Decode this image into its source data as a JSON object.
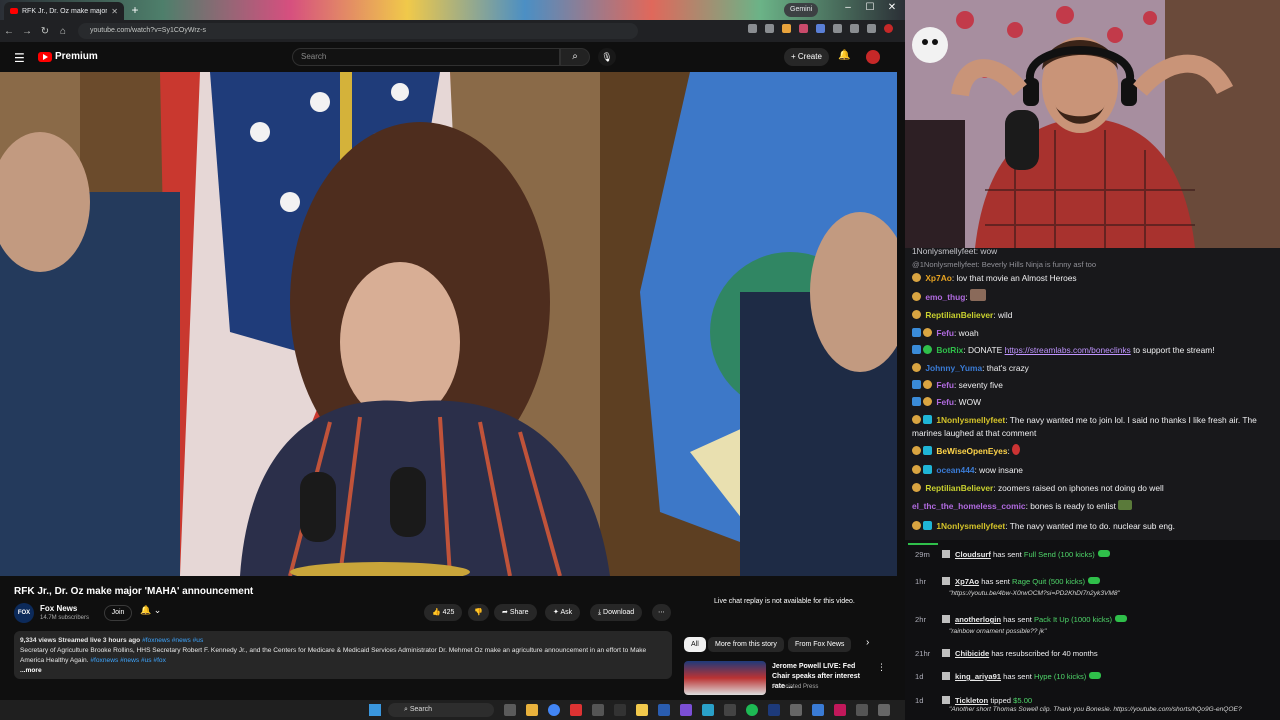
{
  "browser": {
    "tab_title": "RFK Jr., Dr. Oz make major 'MA",
    "gemini_label": "Gemini",
    "url": "youtube.com/watch?v=Sy1COyWrz-s"
  },
  "youtube": {
    "brand": "Premium",
    "search_placeholder": "Search",
    "create_label": "Create"
  },
  "video": {
    "title": "RFK Jr., Dr. Oz make major 'MAHA' announcement",
    "channel": "Fox News",
    "subscribers": "14.7M subscribers",
    "join_label": "Join",
    "likes": "425",
    "share_label": "Share",
    "ask_label": "Ask",
    "download_label": "Download",
    "description": {
      "meta": "9,334 views  Streamed live 3 hours ago",
      "meta_tags": "#foxnews #news #us",
      "body": "Secretary of Agriculture Brooke Rollins, HHS Secretary Robert F. Kennedy Jr., and the Centers for Medicare & Medicaid Services Administrator Dr. Mehmet Oz make an agriculture announcement in an effort to Make America Healthy Again.",
      "body_tags": "#foxnews #news #us #fox",
      "more": "...more"
    }
  },
  "sidebar": {
    "replay_note": "Live chat replay is not available for this video.",
    "chips": [
      "All",
      "More from this story",
      "From Fox News"
    ],
    "rec_title": "Jerome Powell LIVE: Fed Chair speaks after interest rate ...",
    "rec_channel": "Associated Press"
  },
  "chat": {
    "top_cut": "1Nonlysmellyfeet: wow",
    "reply": "@1Nonlysmellyfeet: Beverly Hills Ninja is funny asf too",
    "messages": [
      {
        "user": "Xp7Ao",
        "color": "#e7a321",
        "text": "lov that movie an Almost Heroes"
      },
      {
        "user": "emo_thug",
        "color": "#b06adf",
        "text": ""
      },
      {
        "user": "ReptilianBeliever",
        "color": "#c9d12f",
        "text": "wild"
      },
      {
        "user": "Fefu",
        "color": "#b06adf",
        "text": "woah"
      },
      {
        "user": "BotRix",
        "color": "#2fbf4a",
        "text": "DONATE",
        "link": "https://streamlabs.com/boneclinks",
        "tail": "to support the stream!"
      },
      {
        "user": "Johnny_Yuma",
        "color": "#3a7bd5",
        "text": "that's crazy"
      },
      {
        "user": "Fefu",
        "color": "#b06adf",
        "text": "seventy five"
      },
      {
        "user": "Fefu",
        "color": "#b06adf",
        "text": "WOW"
      },
      {
        "user": "1Nonlysmellyfeet",
        "color": "#d4c32a",
        "text": "The navy wanted me to join lol. I said no thanks I like fresh air. The marines laughed at that comment"
      },
      {
        "user": "BeWiseOpenEyes",
        "color": "#ffd54a",
        "text": ""
      },
      {
        "user": "ocean444",
        "color": "#3a7bd5",
        "text": "wow insane"
      },
      {
        "user": "ReptilianBeliever",
        "color": "#c9d12f",
        "text": "zoomers raised on iphones not doing do well"
      },
      {
        "user": "el_thc_the_homeless_comic",
        "color": "#b06adf",
        "text": "bones is ready to enlist"
      },
      {
        "user": "1Nonlysmellyfeet",
        "color": "#d4c32a",
        "text": "The navy wanted me to do. nuclear sub eng."
      }
    ]
  },
  "events": [
    {
      "time": "29m",
      "user": "Cloudsurf",
      "action": "has sent",
      "item": "Full Send (100 kicks)",
      "note": ""
    },
    {
      "time": "1hr",
      "user": "Xp7Ao",
      "action": "has sent",
      "item": "Rage Quit (500 kicks)",
      "note": "\"https://youtu.be/4bw-X0rwOCM?si=PD2KhDI7n2yk3VM8\""
    },
    {
      "time": "2hr",
      "user": "anotherlogin",
      "action": "has sent",
      "item": "Pack It Up (1000 kicks)",
      "note": "\"rainbow ornament possible?? jk\""
    },
    {
      "time": "21hr",
      "user": "Chibicide",
      "action": "has resubscribed for 40 months",
      "item": "",
      "note": ""
    },
    {
      "time": "1d",
      "user": "king_ariya91",
      "action": "has sent",
      "item": "Hype (10 kicks)",
      "note": ""
    },
    {
      "time": "1d",
      "user": "Tickleton",
      "action": "tipped",
      "item": "$5.00",
      "note": "\"Another short Thomas Sowell clip. Thank you Bonesie. https://youtube.com/shorts/hQo9G-enQOE?"
    }
  ],
  "taskbar": {
    "search_label": "Search"
  }
}
